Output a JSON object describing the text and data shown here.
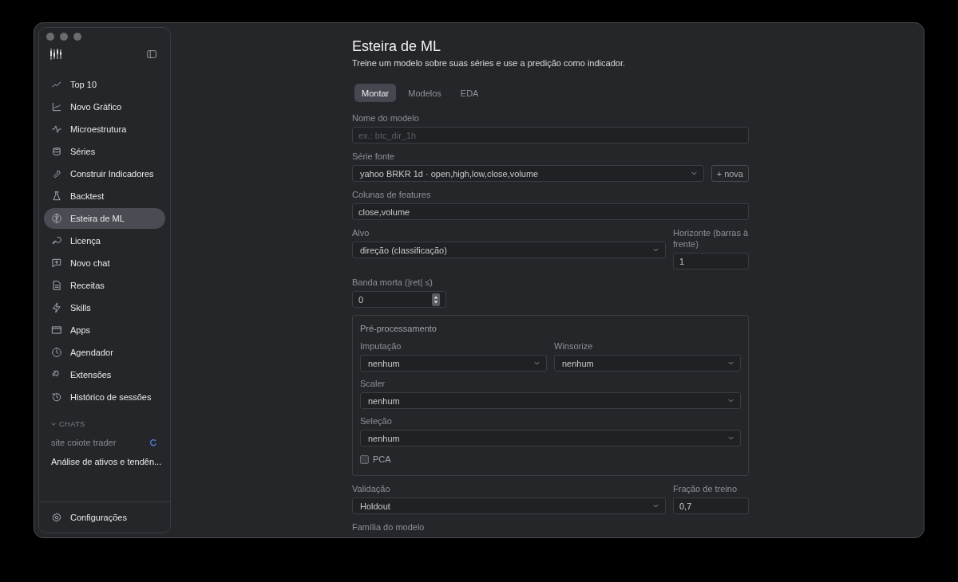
{
  "sidebar": {
    "nav": [
      {
        "label": "Top 10",
        "selected": false
      },
      {
        "label": "Novo Gráfico",
        "selected": false
      },
      {
        "label": "Microestrutura",
        "selected": false
      },
      {
        "label": "Séries",
        "selected": false
      },
      {
        "label": "Construir Indicadores",
        "selected": false
      },
      {
        "label": "Backtest",
        "selected": false
      },
      {
        "label": "Esteira de ML",
        "selected": true
      },
      {
        "label": "Licença",
        "selected": false
      },
      {
        "label": "Novo chat",
        "selected": false
      },
      {
        "label": "Receitas",
        "selected": false
      },
      {
        "label": "Skills",
        "selected": false
      },
      {
        "label": "Apps",
        "selected": false
      },
      {
        "label": "Agendador",
        "selected": false
      },
      {
        "label": "Extensões",
        "selected": false
      },
      {
        "label": "Histórico de sessões",
        "selected": false
      }
    ],
    "chats": {
      "title": "CHATS",
      "expanded": true,
      "items": [
        {
          "title": "site coiote trader",
          "loading": true
        },
        {
          "title": "Análise de ativos e tendên...",
          "loading": false
        }
      ]
    },
    "footer": "Configurações"
  },
  "page": {
    "title": "Esteira de ML",
    "subtitle": "Treine um modelo sobre suas séries e use a predição como indicador."
  },
  "tabs": [
    {
      "label": "Montar",
      "selected": true
    },
    {
      "label": "Modelos",
      "selected": false
    },
    {
      "label": "EDA",
      "selected": false
    }
  ],
  "form": [
    {
      "kind": "row",
      "fields": [
        {
          "kind": "text",
          "label": "Nome do modelo",
          "placeholder": "ex.: btc_dir_1h"
        }
      ]
    },
    {
      "kind": "row",
      "button": "+ nova",
      "fields": [
        {
          "kind": "select",
          "label": "Série fonte",
          "value": "yahoo BRKR 1d · open,high,low,close,volume"
        }
      ]
    },
    {
      "kind": "row",
      "fields": [
        {
          "kind": "text",
          "label": "Colunas de features",
          "value": "close,volume"
        }
      ]
    },
    {
      "kind": "row",
      "fields": [
        {
          "kind": "select",
          "label": "Alvo",
          "value": "direção (classificação)"
        },
        {
          "kind": "text",
          "label": "Horizonte (barras à frente)",
          "value": "1"
        }
      ]
    },
    {
      "kind": "row",
      "fields": [
        {
          "kind": "number",
          "label": "Banda morta (|ret| ≤)",
          "value": "0"
        }
      ]
    },
    {
      "kind": "panel",
      "title": "Pré-processamento",
      "rows": [
        {
          "fields": [
            {
              "kind": "select",
              "label": "Imputação",
              "value": "nenhum"
            },
            {
              "kind": "select",
              "label": "Winsorize",
              "value": "nenhum"
            }
          ]
        },
        {
          "fields": [
            {
              "kind": "select",
              "label": "Scaler",
              "value": "nenhum"
            }
          ]
        },
        {
          "fields": [
            {
              "kind": "select",
              "label": "Seleção",
              "value": "nenhum"
            }
          ]
        },
        {
          "fields": [
            {
              "kind": "checkbox",
              "label": "PCA",
              "checked": false
            }
          ]
        }
      ]
    },
    {
      "kind": "row",
      "fields": [
        {
          "kind": "select",
          "label": "Validação",
          "value": "Holdout"
        },
        {
          "kind": "text",
          "label": "Fração de treino",
          "value": "0,7"
        }
      ]
    },
    {
      "kind": "row",
      "fields": [
        {
          "kind": "heading",
          "label": "Família do modelo"
        }
      ]
    }
  ]
}
